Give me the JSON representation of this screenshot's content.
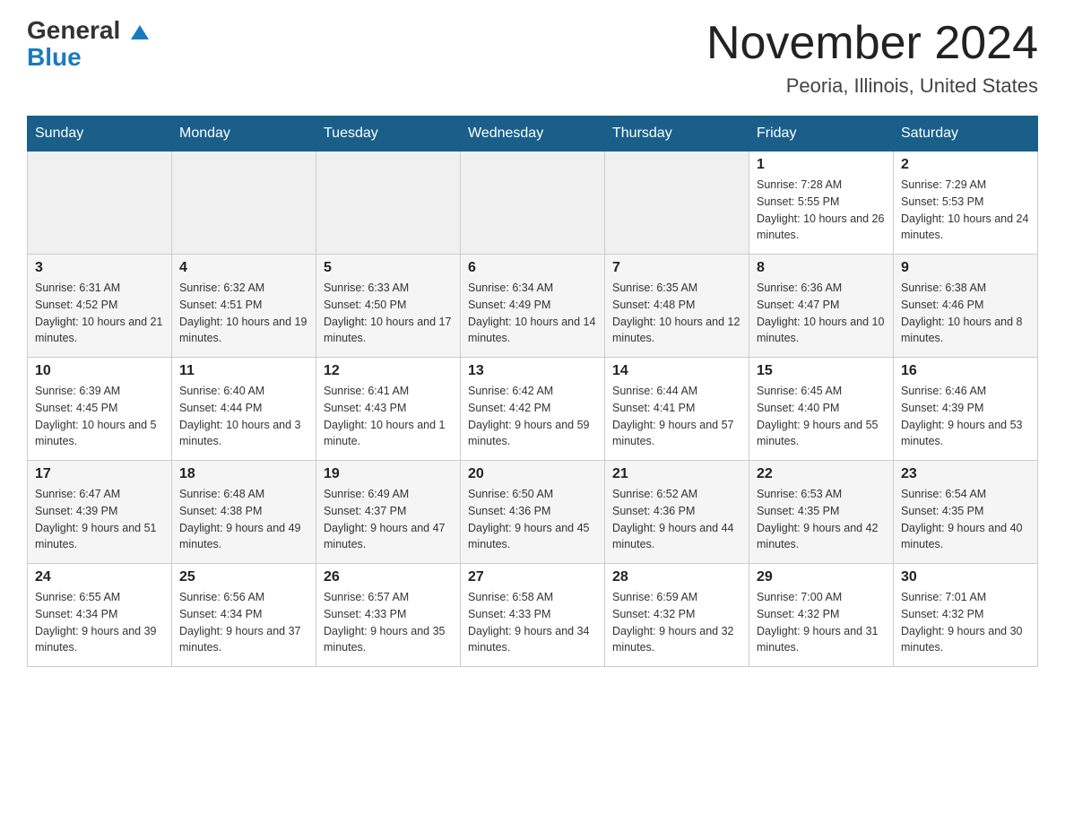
{
  "logo": {
    "general": "General",
    "blue": "Blue"
  },
  "title": "November 2024",
  "subtitle": "Peoria, Illinois, United States",
  "weekdays": [
    "Sunday",
    "Monday",
    "Tuesday",
    "Wednesday",
    "Thursday",
    "Friday",
    "Saturday"
  ],
  "weeks": [
    [
      {
        "day": "",
        "sunrise": "",
        "sunset": "",
        "daylight": ""
      },
      {
        "day": "",
        "sunrise": "",
        "sunset": "",
        "daylight": ""
      },
      {
        "day": "",
        "sunrise": "",
        "sunset": "",
        "daylight": ""
      },
      {
        "day": "",
        "sunrise": "",
        "sunset": "",
        "daylight": ""
      },
      {
        "day": "",
        "sunrise": "",
        "sunset": "",
        "daylight": ""
      },
      {
        "day": "1",
        "sunrise": "Sunrise: 7:28 AM",
        "sunset": "Sunset: 5:55 PM",
        "daylight": "Daylight: 10 hours and 26 minutes."
      },
      {
        "day": "2",
        "sunrise": "Sunrise: 7:29 AM",
        "sunset": "Sunset: 5:53 PM",
        "daylight": "Daylight: 10 hours and 24 minutes."
      }
    ],
    [
      {
        "day": "3",
        "sunrise": "Sunrise: 6:31 AM",
        "sunset": "Sunset: 4:52 PM",
        "daylight": "Daylight: 10 hours and 21 minutes."
      },
      {
        "day": "4",
        "sunrise": "Sunrise: 6:32 AM",
        "sunset": "Sunset: 4:51 PM",
        "daylight": "Daylight: 10 hours and 19 minutes."
      },
      {
        "day": "5",
        "sunrise": "Sunrise: 6:33 AM",
        "sunset": "Sunset: 4:50 PM",
        "daylight": "Daylight: 10 hours and 17 minutes."
      },
      {
        "day": "6",
        "sunrise": "Sunrise: 6:34 AM",
        "sunset": "Sunset: 4:49 PM",
        "daylight": "Daylight: 10 hours and 14 minutes."
      },
      {
        "day": "7",
        "sunrise": "Sunrise: 6:35 AM",
        "sunset": "Sunset: 4:48 PM",
        "daylight": "Daylight: 10 hours and 12 minutes."
      },
      {
        "day": "8",
        "sunrise": "Sunrise: 6:36 AM",
        "sunset": "Sunset: 4:47 PM",
        "daylight": "Daylight: 10 hours and 10 minutes."
      },
      {
        "day": "9",
        "sunrise": "Sunrise: 6:38 AM",
        "sunset": "Sunset: 4:46 PM",
        "daylight": "Daylight: 10 hours and 8 minutes."
      }
    ],
    [
      {
        "day": "10",
        "sunrise": "Sunrise: 6:39 AM",
        "sunset": "Sunset: 4:45 PM",
        "daylight": "Daylight: 10 hours and 5 minutes."
      },
      {
        "day": "11",
        "sunrise": "Sunrise: 6:40 AM",
        "sunset": "Sunset: 4:44 PM",
        "daylight": "Daylight: 10 hours and 3 minutes."
      },
      {
        "day": "12",
        "sunrise": "Sunrise: 6:41 AM",
        "sunset": "Sunset: 4:43 PM",
        "daylight": "Daylight: 10 hours and 1 minute."
      },
      {
        "day": "13",
        "sunrise": "Sunrise: 6:42 AM",
        "sunset": "Sunset: 4:42 PM",
        "daylight": "Daylight: 9 hours and 59 minutes."
      },
      {
        "day": "14",
        "sunrise": "Sunrise: 6:44 AM",
        "sunset": "Sunset: 4:41 PM",
        "daylight": "Daylight: 9 hours and 57 minutes."
      },
      {
        "day": "15",
        "sunrise": "Sunrise: 6:45 AM",
        "sunset": "Sunset: 4:40 PM",
        "daylight": "Daylight: 9 hours and 55 minutes."
      },
      {
        "day": "16",
        "sunrise": "Sunrise: 6:46 AM",
        "sunset": "Sunset: 4:39 PM",
        "daylight": "Daylight: 9 hours and 53 minutes."
      }
    ],
    [
      {
        "day": "17",
        "sunrise": "Sunrise: 6:47 AM",
        "sunset": "Sunset: 4:39 PM",
        "daylight": "Daylight: 9 hours and 51 minutes."
      },
      {
        "day": "18",
        "sunrise": "Sunrise: 6:48 AM",
        "sunset": "Sunset: 4:38 PM",
        "daylight": "Daylight: 9 hours and 49 minutes."
      },
      {
        "day": "19",
        "sunrise": "Sunrise: 6:49 AM",
        "sunset": "Sunset: 4:37 PM",
        "daylight": "Daylight: 9 hours and 47 minutes."
      },
      {
        "day": "20",
        "sunrise": "Sunrise: 6:50 AM",
        "sunset": "Sunset: 4:36 PM",
        "daylight": "Daylight: 9 hours and 45 minutes."
      },
      {
        "day": "21",
        "sunrise": "Sunrise: 6:52 AM",
        "sunset": "Sunset: 4:36 PM",
        "daylight": "Daylight: 9 hours and 44 minutes."
      },
      {
        "day": "22",
        "sunrise": "Sunrise: 6:53 AM",
        "sunset": "Sunset: 4:35 PM",
        "daylight": "Daylight: 9 hours and 42 minutes."
      },
      {
        "day": "23",
        "sunrise": "Sunrise: 6:54 AM",
        "sunset": "Sunset: 4:35 PM",
        "daylight": "Daylight: 9 hours and 40 minutes."
      }
    ],
    [
      {
        "day": "24",
        "sunrise": "Sunrise: 6:55 AM",
        "sunset": "Sunset: 4:34 PM",
        "daylight": "Daylight: 9 hours and 39 minutes."
      },
      {
        "day": "25",
        "sunrise": "Sunrise: 6:56 AM",
        "sunset": "Sunset: 4:34 PM",
        "daylight": "Daylight: 9 hours and 37 minutes."
      },
      {
        "day": "26",
        "sunrise": "Sunrise: 6:57 AM",
        "sunset": "Sunset: 4:33 PM",
        "daylight": "Daylight: 9 hours and 35 minutes."
      },
      {
        "day": "27",
        "sunrise": "Sunrise: 6:58 AM",
        "sunset": "Sunset: 4:33 PM",
        "daylight": "Daylight: 9 hours and 34 minutes."
      },
      {
        "day": "28",
        "sunrise": "Sunrise: 6:59 AM",
        "sunset": "Sunset: 4:32 PM",
        "daylight": "Daylight: 9 hours and 32 minutes."
      },
      {
        "day": "29",
        "sunrise": "Sunrise: 7:00 AM",
        "sunset": "Sunset: 4:32 PM",
        "daylight": "Daylight: 9 hours and 31 minutes."
      },
      {
        "day": "30",
        "sunrise": "Sunrise: 7:01 AM",
        "sunset": "Sunset: 4:32 PM",
        "daylight": "Daylight: 9 hours and 30 minutes."
      }
    ]
  ]
}
